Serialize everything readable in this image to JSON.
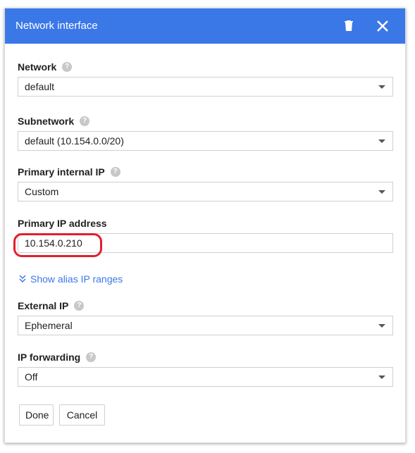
{
  "dialog": {
    "title": "Network interface",
    "delete_icon": "trash-icon",
    "close_icon": "close-icon",
    "header_color": "#3b78e7"
  },
  "fields": {
    "network": {
      "label": "Network",
      "value": "default"
    },
    "subnetwork": {
      "label": "Subnetwork",
      "value": "default (10.154.0.0/20)"
    },
    "primary_internal_ip": {
      "label": "Primary internal IP",
      "value": "Custom"
    },
    "primary_ip_address": {
      "label": "Primary IP address",
      "value": "10.154.0.210"
    },
    "external_ip": {
      "label": "External IP",
      "value": "Ephemeral"
    },
    "ip_forwarding": {
      "label": "IP forwarding",
      "value": "Off"
    }
  },
  "alias_link": {
    "label": "Show alias IP ranges",
    "icon": "double-chevron-down-icon"
  },
  "help_icon": "?",
  "buttons": {
    "done": "Done",
    "cancel": "Cancel"
  },
  "highlight_color": "#e0202e",
  "link_color": "#3b78e7"
}
